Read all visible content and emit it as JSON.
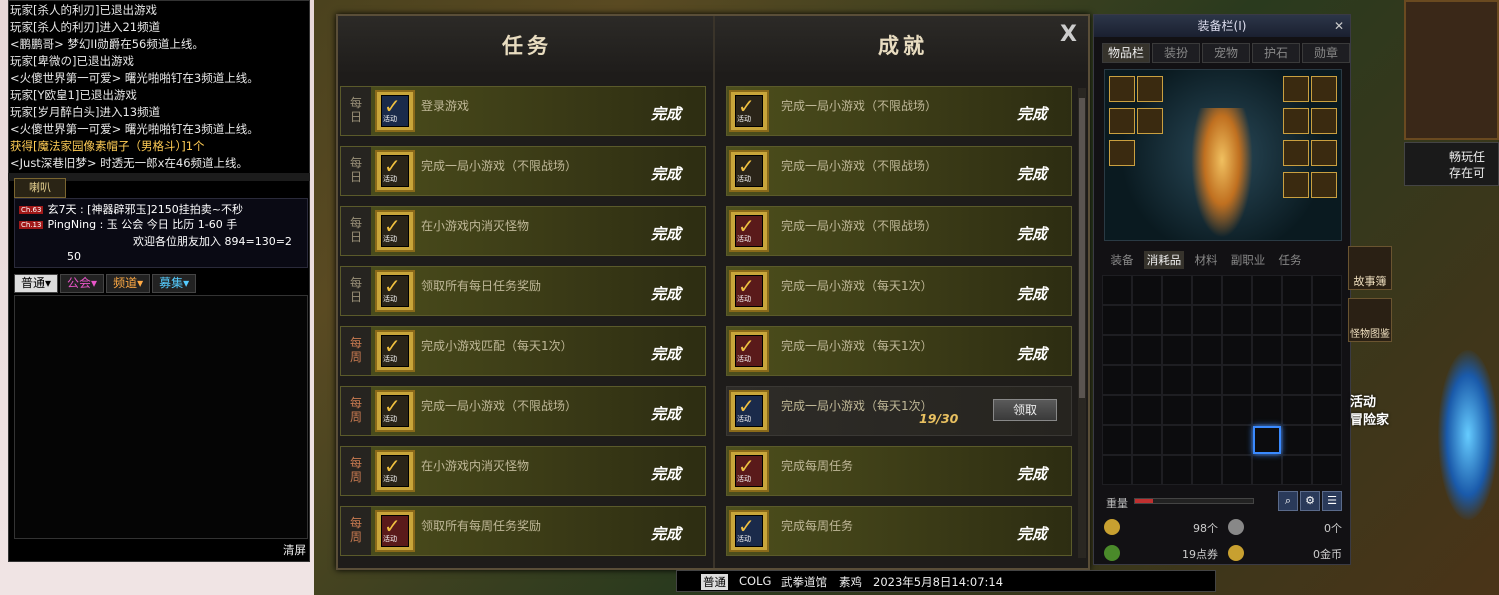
{
  "chat": {
    "lines": [
      "玩家[杀人的利刃]已退出游戏",
      "玩家[杀人的利刃]进入21频道",
      "<鹏鹏哥> 梦幻II勋爵在56频道上线。",
      "玩家[卑微の]已退出游戏",
      "<火傻世界第一可爱> 曙光啪啪钉在3频道上线。",
      "玩家[Y欧皇1]已退出游戏",
      "玩家[岁月醉白头]进入13频道",
      "<火傻世界第一可爱> 曙光啪啪钉在3频道上线。",
      "获得[魔法家园像素帽子（男格斗）]1个",
      "<Just深巷旧梦> 时透无一郎x在46频道上线。"
    ],
    "trumpet_label": "喇叭",
    "mega": [
      {
        "ch": "Ch.63",
        "text": "玄7天 : [神器辟邪玉]2150挂拍卖~不秒"
      },
      {
        "ch": "Ch.13",
        "text": "PingNing : 玉 公会   今日 比历  1-60  手"
      },
      {
        "ch": "",
        "text": "欢迎各位朋友加入  894=130=2"
      },
      {
        "ch": "",
        "text": "50"
      }
    ],
    "tabs": [
      "普通▾",
      "公会▾",
      "频道▾",
      "募集▾"
    ],
    "clear_label": "清屏"
  },
  "window": {
    "tab_quest": "任务",
    "tab_achievement": "成就",
    "close": "X",
    "quests": [
      {
        "tag": "每日",
        "weekly": false,
        "text": "登录游戏",
        "status": "完成",
        "icon": "blue"
      },
      {
        "tag": "每日",
        "weekly": false,
        "text": "完成一局小游戏（不限战场）",
        "status": "完成",
        "icon": "gold"
      },
      {
        "tag": "每日",
        "weekly": false,
        "text": "在小游戏内消灭怪物",
        "status": "完成",
        "icon": "gold"
      },
      {
        "tag": "每日",
        "weekly": false,
        "text": "领取所有每日任务奖励",
        "status": "完成",
        "icon": "gold"
      },
      {
        "tag": "每周",
        "weekly": true,
        "text": "完成小游戏匹配（每天1次）",
        "status": "完成",
        "icon": "gold"
      },
      {
        "tag": "每周",
        "weekly": true,
        "text": "完成一局小游戏（不限战场）",
        "status": "完成",
        "icon": "gold"
      },
      {
        "tag": "每周",
        "weekly": true,
        "text": "在小游戏内消灭怪物",
        "status": "完成",
        "icon": "gold"
      },
      {
        "tag": "每周",
        "weekly": true,
        "text": "领取所有每周任务奖励",
        "status": "完成",
        "icon": "red"
      }
    ],
    "achievements": [
      {
        "text": "完成一局小游戏（不限战场）",
        "status": "完成",
        "icon": "gold"
      },
      {
        "text": "完成一局小游戏（不限战场）",
        "status": "完成",
        "icon": "gold"
      },
      {
        "text": "完成一局小游戏（不限战场）",
        "status": "完成",
        "icon": "red"
      },
      {
        "text": "完成一局小游戏（每天1次）",
        "status": "完成",
        "icon": "red"
      },
      {
        "text": "完成一局小游戏（每天1次）",
        "status": "完成",
        "icon": "red"
      },
      {
        "text": "完成一局小游戏（每天1次）",
        "status": "",
        "icon": "blue",
        "progress": "19/30",
        "claim": "领取"
      },
      {
        "text": "完成每周任务",
        "status": "完成",
        "icon": "red"
      },
      {
        "text": "完成每周任务",
        "status": "完成",
        "icon": "blue"
      }
    ],
    "icon_label": "活动"
  },
  "equip": {
    "title": "装备栏(I)",
    "tabs": [
      "物品栏",
      "装扮",
      "宠物",
      "护石",
      "勋章"
    ],
    "inv_tabs": [
      "装备",
      "消耗品",
      "材料",
      "副职业",
      "任务"
    ],
    "weight_label": "重量",
    "money": [
      {
        "label": "98个"
      },
      {
        "label": "0个"
      },
      {
        "label": "19点券"
      },
      {
        "label": "0金币"
      }
    ]
  },
  "side": {
    "story": "故事簿",
    "monster": "怪物图鉴",
    "notice": "畅玩任\n存在可",
    "event": "活动\n冒险家"
  },
  "status": {
    "mode": "普通",
    "server": "COLG",
    "location": "武拳道馆",
    "name": "素鸡",
    "datetime": "2023年5月8日14:07:14"
  }
}
